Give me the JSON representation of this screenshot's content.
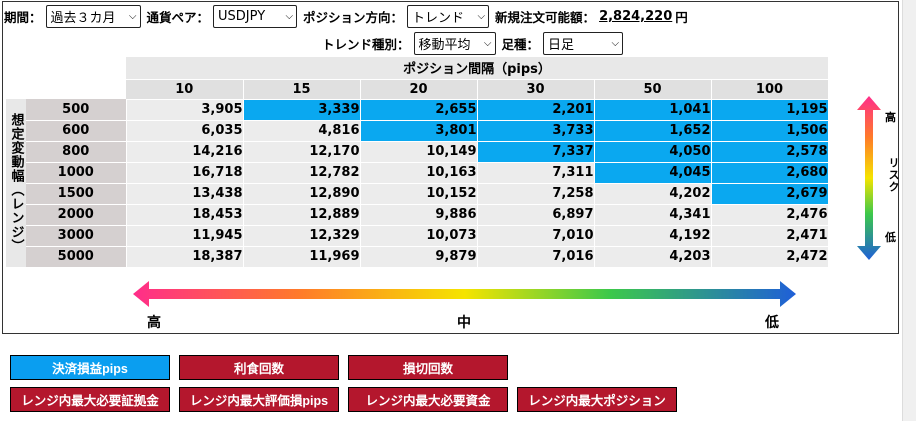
{
  "filters": {
    "period_label": "期間：",
    "period_value": "過去３カ月",
    "pair_label": "通貨ペア：",
    "pair_value": "USDJPY",
    "direction_label": "ポジション方向：",
    "direction_value": "トレンド",
    "available_label": "新規注文可能額：",
    "available_value": "2,824,220",
    "available_unit": "円",
    "trend_type_label": "トレンド種別：",
    "trend_type_value": "移動平均",
    "bar_label": "足種：",
    "bar_value": "日足"
  },
  "grid": {
    "caption": "ポジション間隔（pips）",
    "side_label": "想定変動幅（レンジ）",
    "columns": [
      "10",
      "15",
      "20",
      "30",
      "50",
      "100"
    ],
    "rows": [
      {
        "label": "500",
        "cells": [
          "3,905",
          "3,339",
          "2,655",
          "2,201",
          "1,041",
          "1,195"
        ],
        "hl": [
          false,
          true,
          true,
          true,
          true,
          true
        ]
      },
      {
        "label": "600",
        "cells": [
          "6,035",
          "4,816",
          "3,801",
          "3,733",
          "1,652",
          "1,506"
        ],
        "hl": [
          false,
          false,
          true,
          true,
          true,
          true
        ]
      },
      {
        "label": "800",
        "cells": [
          "14,216",
          "12,170",
          "10,149",
          "7,337",
          "4,050",
          "2,578"
        ],
        "hl": [
          false,
          false,
          false,
          true,
          true,
          true
        ]
      },
      {
        "label": "1000",
        "cells": [
          "16,718",
          "12,782",
          "10,163",
          "7,311",
          "4,045",
          "2,680"
        ],
        "hl": [
          false,
          false,
          false,
          false,
          true,
          true
        ]
      },
      {
        "label": "1500",
        "cells": [
          "13,438",
          "12,890",
          "10,152",
          "7,258",
          "4,202",
          "2,679"
        ],
        "hl": [
          false,
          false,
          false,
          false,
          false,
          true
        ]
      },
      {
        "label": "2000",
        "cells": [
          "18,453",
          "12,889",
          "9,886",
          "6,897",
          "4,341",
          "2,476"
        ],
        "hl": [
          false,
          false,
          false,
          false,
          false,
          false
        ]
      },
      {
        "label": "3000",
        "cells": [
          "11,945",
          "12,329",
          "10,073",
          "7,010",
          "4,192",
          "2,471"
        ],
        "hl": [
          false,
          false,
          false,
          false,
          false,
          false
        ]
      },
      {
        "label": "5000",
        "cells": [
          "18,387",
          "11,969",
          "9,879",
          "7,016",
          "4,203",
          "2,472"
        ],
        "hl": [
          false,
          false,
          false,
          false,
          false,
          false
        ]
      }
    ],
    "highlight_color": "#0aa8f0"
  },
  "risk_scale": {
    "high": "高",
    "middle": "リスク",
    "low": "低"
  },
  "horizontal_scale": {
    "left": "高",
    "middle": "中",
    "right": "低"
  },
  "buttons": [
    {
      "label": "決済損益pips",
      "active": true
    },
    {
      "label": "利食回数",
      "active": false
    },
    {
      "label": "損切回数",
      "active": false
    },
    {
      "label": "レンジ内最大必要証拠金",
      "active": false
    },
    {
      "label": "レンジ内最大評価損pips",
      "active": false
    },
    {
      "label": "レンジ内最大必要資金",
      "active": false
    },
    {
      "label": "レンジ内最大ポジション",
      "active": false
    }
  ],
  "colors": {
    "active_button": "#0a9ef0",
    "inactive_button": "#b4172d"
  }
}
